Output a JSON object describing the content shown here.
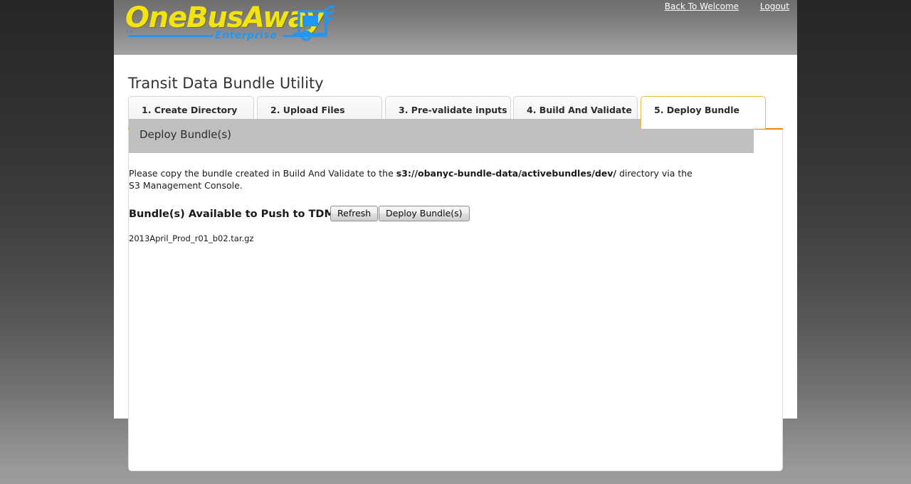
{
  "header": {
    "logo_wordmark": "OneBusAway",
    "logo_subtitle": "Enterprise",
    "nav": [
      {
        "label": "Back To Welcome"
      },
      {
        "label": "Logout"
      }
    ]
  },
  "main": {
    "page_title": "Transit Data Bundle Utility",
    "tabs": [
      {
        "label": "1. Create Directory",
        "active": false
      },
      {
        "label": "2. Upload Files",
        "active": false
      },
      {
        "label": "3. Pre-validate inputs",
        "active": false
      },
      {
        "label": "4. Build And Validate",
        "active": false
      },
      {
        "label": "5. Deploy Bundle",
        "active": true
      }
    ],
    "panel": {
      "heading": "Deploy Bundle(s)",
      "instructions_part1": "Please copy the bundle created in Build And Validate to the ",
      "instructions_path": "s3://obanyc-bundle-data/activebundles/dev/",
      "instructions_part2": " directory via the S3 Management Console.",
      "bundle_row_label": "Bundle(s) Available to Push to TDM",
      "refresh_button": "Refresh",
      "deploy_button": "Deploy Bundle(s)",
      "bundles": [
        "2013April_Prod_r01_b02.tar.gz"
      ]
    }
  },
  "colors": {
    "accent_orange": "#e8890c",
    "active_tab_border": "#f0bb45",
    "logo_yellow": "#f2e40c",
    "logo_blue": "#2196f3",
    "panel_heading_bg": "#bfbfbf"
  }
}
